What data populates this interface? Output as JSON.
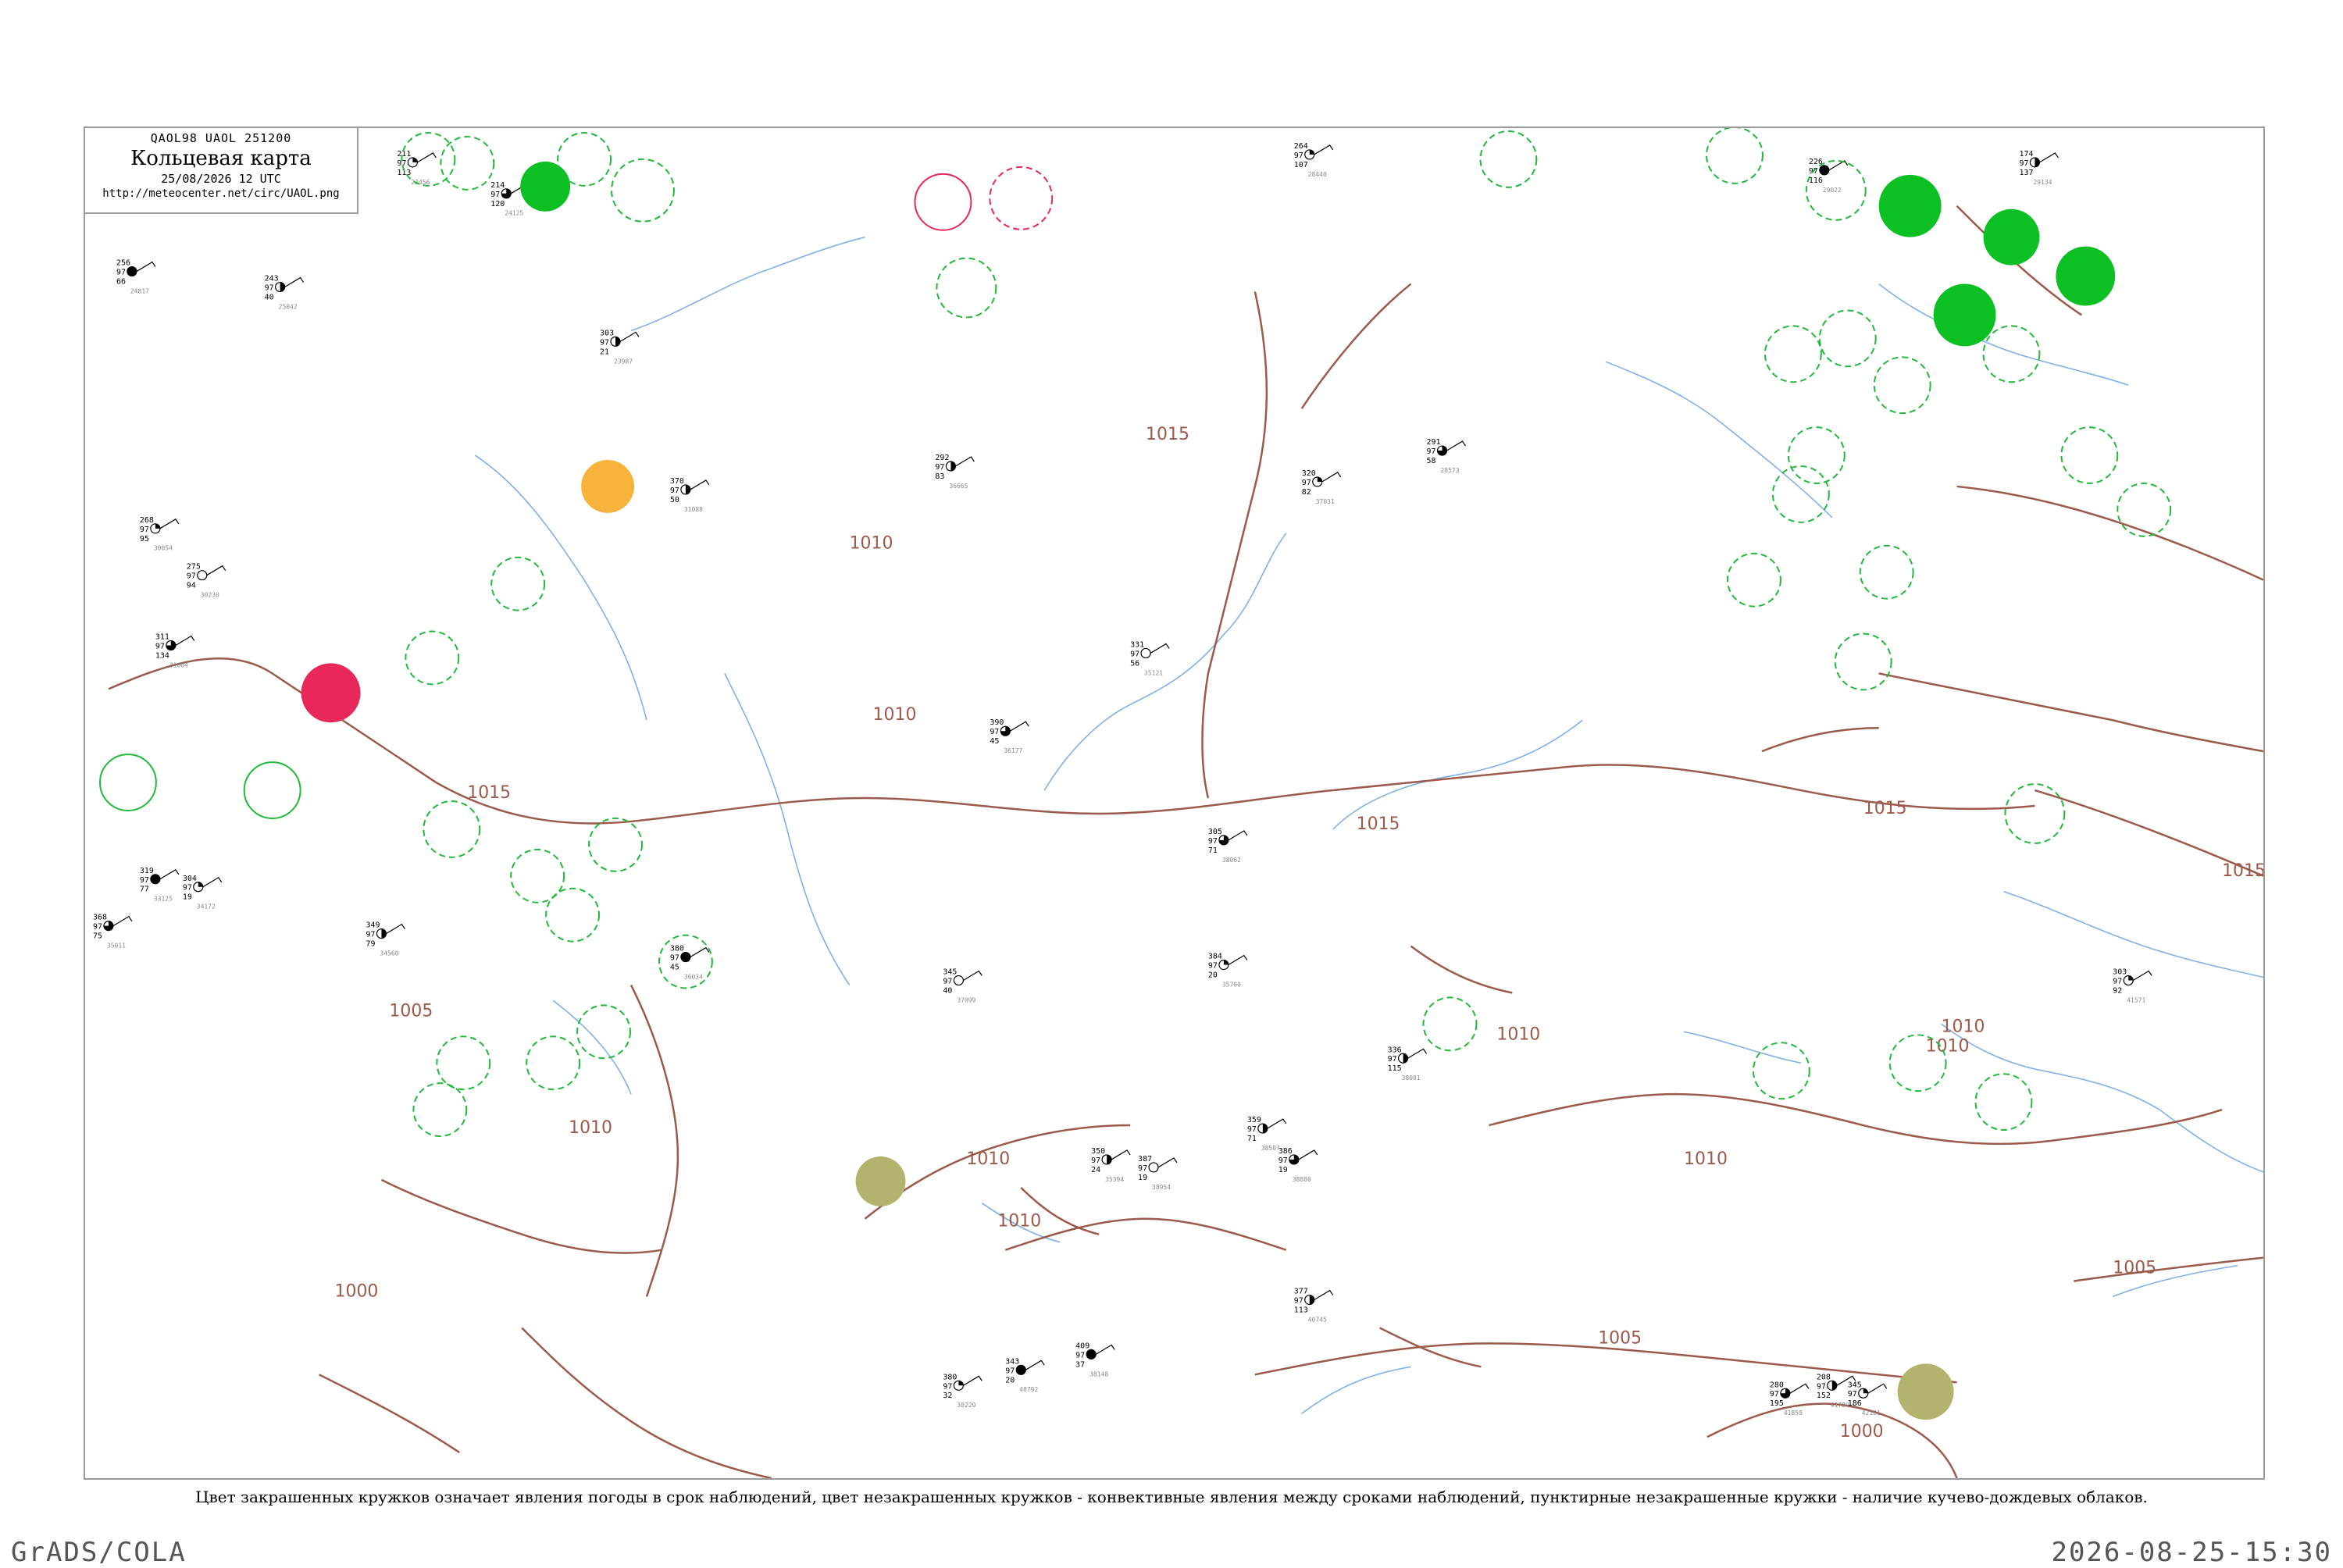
{
  "header": {
    "code_line": "QAOL98  UAOL  251200",
    "title": "Кольцевая карта",
    "date_line": "25/08/2026 12 UTC",
    "url": "http://meteocenter.net/circ/UAOL.png"
  },
  "footnote": "Цвет закрашенных кружков означает явления погоды в срок наблюдений, цвет незакрашенных кружков - конвективные явления между сроками наблюдений, пунктирные незакрашенные кружки - наличие кучево-дождевых облаков.",
  "footer": {
    "left": "GrADS/COLA",
    "right": "2026-08-25-15:30"
  },
  "colors": {
    "isobar": "#9b5a4a",
    "water": "#7fb0e6",
    "cb_dashed": "#22b83a",
    "rain_fill": "#0cbf23",
    "thunder_fill": "#e8285a",
    "haze_fill": "#f7b23b",
    "dust_fill": "#b3b36e",
    "border": "#9a9a9a"
  },
  "isobars": [
    {
      "label": "1015"
    },
    {
      "label": "1010"
    },
    {
      "label": "1005"
    },
    {
      "label": "1000"
    }
  ],
  "stations": [
    {
      "p": "211",
      "t": "97",
      "v": "113",
      "id": "23456"
    },
    {
      "p": "303",
      "t": "97",
      "v": "21",
      "id": "23987"
    },
    {
      "p": "214",
      "t": "97",
      "v": "120",
      "id": "24125"
    },
    {
      "p": "256",
      "t": "97",
      "v": "66",
      "id": "24817"
    },
    {
      "p": "243",
      "t": "97",
      "v": "40",
      "id": "25042"
    },
    {
      "p": "264",
      "t": "97",
      "v": "107",
      "id": "28440"
    },
    {
      "p": "291",
      "t": "97",
      "v": "58",
      "id": "28573"
    },
    {
      "p": "226",
      "t": "97",
      "v": "116",
      "id": "29022"
    },
    {
      "p": "174",
      "t": "97",
      "v": "137",
      "id": "29134"
    },
    {
      "p": "268",
      "t": "97",
      "v": "95",
      "id": "30054"
    },
    {
      "p": "275",
      "t": "97",
      "v": "94",
      "id": "30230"
    },
    {
      "p": "311",
      "t": "97",
      "v": "134",
      "id": "31004"
    },
    {
      "p": "370",
      "t": "97",
      "v": "50",
      "id": "31088"
    },
    {
      "p": "319",
      "t": "97",
      "v": "77",
      "id": "33125"
    },
    {
      "p": "304",
      "t": "97",
      "v": "19",
      "id": "34172"
    },
    {
      "p": "349",
      "t": "97",
      "v": "79",
      "id": "34560"
    },
    {
      "p": "368",
      "t": "97",
      "v": "75",
      "id": "35011"
    },
    {
      "p": "331",
      "t": "97",
      "v": "56",
      "id": "35121"
    },
    {
      "p": "350",
      "t": "97",
      "v": "24",
      "id": "35394"
    },
    {
      "p": "384",
      "t": "97",
      "v": "20",
      "id": "35700"
    },
    {
      "p": "380",
      "t": "97",
      "v": "45",
      "id": "36034"
    },
    {
      "p": "390",
      "t": "97",
      "v": "45",
      "id": "36177"
    },
    {
      "p": "292",
      "t": "97",
      "v": "83",
      "id": "36665"
    },
    {
      "p": "320",
      "t": "97",
      "v": "82",
      "id": "37031"
    },
    {
      "p": "345",
      "t": "97",
      "v": "40",
      "id": "37099"
    },
    {
      "p": "336",
      "t": "97",
      "v": "115",
      "id": "38001"
    },
    {
      "p": "305",
      "t": "97",
      "v": "71",
      "id": "38062"
    },
    {
      "p": "409",
      "t": "97",
      "v": "37",
      "id": "38148"
    },
    {
      "p": "380",
      "t": "97",
      "v": "32",
      "id": "38220"
    },
    {
      "p": "359",
      "t": "97",
      "v": "71",
      "id": "38507"
    },
    {
      "p": "386",
      "t": "97",
      "v": "19",
      "id": "38880"
    },
    {
      "p": "387",
      "t": "97",
      "v": "19",
      "id": "38954"
    },
    {
      "p": "377",
      "t": "97",
      "v": "113",
      "id": "40745"
    },
    {
      "p": "343",
      "t": "97",
      "v": "20",
      "id": "40792"
    },
    {
      "p": "303",
      "t": "97",
      "v": "92",
      "id": "41571"
    },
    {
      "p": "208",
      "t": "97",
      "v": "152",
      "id": "41780"
    },
    {
      "p": "280",
      "t": "97",
      "v": "195",
      "id": "41859"
    },
    {
      "p": "345",
      "t": "97",
      "v": "186",
      "id": "42101"
    }
  ]
}
